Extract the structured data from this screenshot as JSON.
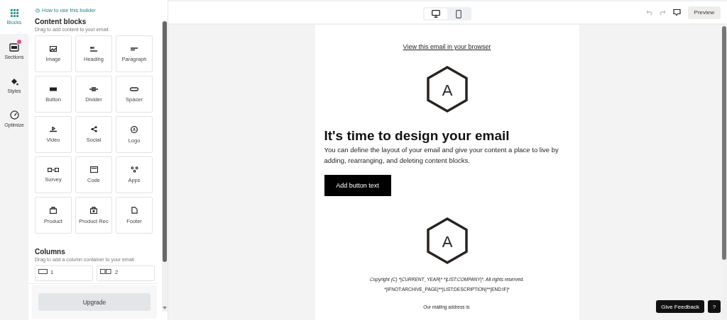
{
  "rail": [
    {
      "label": "Blocks",
      "kind": "grid",
      "selected": true,
      "badge": false
    },
    {
      "label": "Sections",
      "kind": "sections",
      "selected": false,
      "badge": true
    },
    {
      "label": "Styles",
      "kind": "paint",
      "selected": false,
      "badge": false
    },
    {
      "label": "Optimize",
      "kind": "gauge",
      "selected": false,
      "badge": false
    }
  ],
  "panel": {
    "help_link": "How to use this builder",
    "content_title": "Content blocks",
    "content_hint": "Drag to add content to your email",
    "blocks": [
      {
        "label": "Image",
        "kind": "image"
      },
      {
        "label": "Heading",
        "kind": "heading"
      },
      {
        "label": "Paragraph",
        "kind": "paragraph"
      },
      {
        "label": "Button",
        "kind": "button"
      },
      {
        "label": "Divider",
        "kind": "divider"
      },
      {
        "label": "Spacer",
        "kind": "spacer"
      },
      {
        "label": "Video",
        "kind": "video"
      },
      {
        "label": "Social",
        "kind": "social"
      },
      {
        "label": "Logo",
        "kind": "logo"
      },
      {
        "label": "Survey",
        "kind": "survey"
      },
      {
        "label": "Code",
        "kind": "code"
      },
      {
        "label": "Apps",
        "kind": "apps"
      },
      {
        "label": "Product",
        "kind": "bag"
      },
      {
        "label": "Product Rec",
        "kind": "bagstar"
      },
      {
        "label": "Footer",
        "kind": "doc"
      }
    ],
    "columns_title": "Columns",
    "columns_hint": "Drag to add a column container to your email",
    "columns": [
      {
        "label": "1"
      },
      {
        "label": "2"
      }
    ],
    "upgrade": "Upgrade"
  },
  "toolbar": {
    "devices": [
      {
        "kind": "desktop",
        "selected": true
      },
      {
        "kind": "mobile",
        "selected": false
      }
    ],
    "preview": "Preview"
  },
  "email": {
    "browser_link": "View this email in your browser",
    "logo_letter": "A",
    "heading": "It's time to design your email",
    "body": "You can define the layout of your email and give your content a place to live by adding, rearranging, and deleting content blocks.",
    "button": "Add button text",
    "footer_logo_letter": "A",
    "copyright": "Copyright (C) *|CURRENT_YEAR|* *|LIST:COMPANY|*. All rights reserved.",
    "description": "*|IFNOT:ARCHIVE_PAGE|**|LIST:DESCRIPTION|**|END:IF|*",
    "address_label": "Our mailing address is:"
  },
  "feedback": {
    "label": "Give Feedback",
    "help": "?"
  }
}
